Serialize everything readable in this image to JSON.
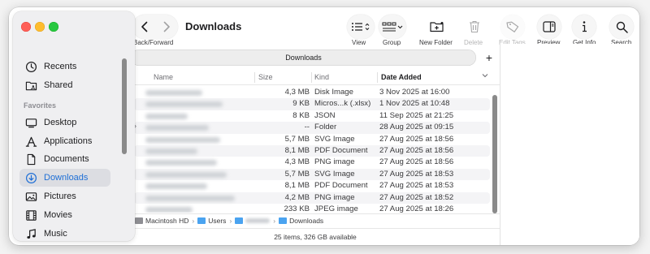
{
  "window": {
    "title": "Downloads"
  },
  "toolbar": {
    "back_forward_label": "Back/Forward",
    "view_label": "View",
    "group_label": "Group",
    "new_folder_label": "New Folder",
    "delete_label": "Delete",
    "edit_tags_label": "Edit Tags",
    "preview_label": "Preview",
    "get_info_label": "Get Info",
    "search_label": "Search"
  },
  "sidebar": {
    "items_top": [
      {
        "label": "Recents",
        "icon": "clock-icon"
      },
      {
        "label": "Shared",
        "icon": "shared-folder-icon"
      }
    ],
    "favorites_label": "Favorites",
    "favorites": [
      {
        "label": "Desktop",
        "icon": "desktop-icon"
      },
      {
        "label": "Applications",
        "icon": "applications-icon"
      },
      {
        "label": "Documents",
        "icon": "document-icon"
      },
      {
        "label": "Downloads",
        "icon": "download-icon",
        "selected": true
      },
      {
        "label": "Pictures",
        "icon": "photo-icon"
      },
      {
        "label": "Movies",
        "icon": "film-icon"
      },
      {
        "label": "Music",
        "icon": "music-note-icon"
      }
    ],
    "accent_color": "#1f6fd6"
  },
  "tabbar": {
    "tab_label": "Downloads",
    "add_tab_symbol": "+"
  },
  "list": {
    "columns": {
      "name": "Name",
      "size": "Size",
      "kind": "Kind",
      "date": "Date Added"
    },
    "rows": [
      {
        "size": "4,3 MB",
        "kind": "Disk Image",
        "date": "3 Nov 2025 at 16:00"
      },
      {
        "size": "9 KB",
        "kind": "Micros...k (.xlsx)",
        "date": "1 Nov 2025 at 10:48"
      },
      {
        "size": "8 KB",
        "kind": "JSON",
        "date": "11 Sep 2025 at 21:25"
      },
      {
        "size": "--",
        "kind": "Folder",
        "date": "28 Aug 2025 at 09:15",
        "is_folder": true
      },
      {
        "size": "5,7 MB",
        "kind": "SVG Image",
        "date": "27 Aug 2025 at 18:56"
      },
      {
        "size": "8,1 MB",
        "kind": "PDF Document",
        "date": "27 Aug 2025 at 18:56"
      },
      {
        "size": "4,3 MB",
        "kind": "PNG image",
        "date": "27 Aug 2025 at 18:56"
      },
      {
        "size": "5,7 MB",
        "kind": "SVG Image",
        "date": "27 Aug 2025 at 18:53"
      },
      {
        "size": "8,1 MB",
        "kind": "PDF Document",
        "date": "27 Aug 2025 at 18:53"
      },
      {
        "size": "4,2 MB",
        "kind": "PNG image",
        "date": "27 Aug 2025 at 18:52"
      },
      {
        "size": "233 KB",
        "kind": "JPEG image",
        "date": "27 Aug 2025 at 18:26"
      }
    ]
  },
  "pathbar": {
    "segments": [
      "Macintosh HD",
      "Users",
      "Downloads"
    ]
  },
  "status": {
    "text": "25 items, 326 GB available"
  }
}
